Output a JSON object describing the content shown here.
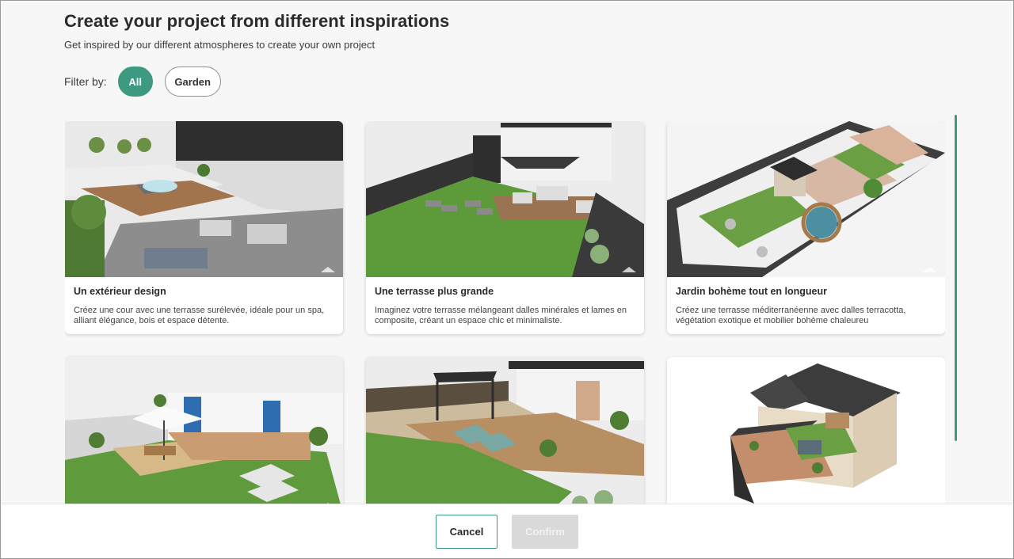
{
  "header": {
    "title": "Create your project from different inspirations",
    "subtitle": "Get inspired by our different atmospheres to create your own project"
  },
  "filter": {
    "label": "Filter by:",
    "options": [
      "All",
      "Garden"
    ],
    "selected": "All"
  },
  "cards": [
    {
      "title": "Un extérieur design",
      "description": "Créez une cour avec une terrasse surélevée, idéale pour un spa, alliant élégance, bois et espace détente."
    },
    {
      "title": "Une terrasse plus grande",
      "description": "Imaginez votre terrasse mélangeant dalles minérales et lames en composite, créant un espace chic et minimaliste."
    },
    {
      "title": "Jardin bohème tout en longueur",
      "description": "Créez une terrasse méditerranéenne avec dalles terracotta, végétation exotique et mobilier bohème chaleureu"
    },
    {
      "title": "",
      "description": ""
    },
    {
      "title": "",
      "description": ""
    },
    {
      "title": "",
      "description": ""
    }
  ],
  "footer": {
    "cancel_label": "Cancel",
    "confirm_label": "Confirm",
    "confirm_enabled": false
  },
  "colors": {
    "accent": "#3d9a80",
    "disabled": "#d9d9d9",
    "grass": "#5c9a3a",
    "deck": "#b8875a"
  }
}
